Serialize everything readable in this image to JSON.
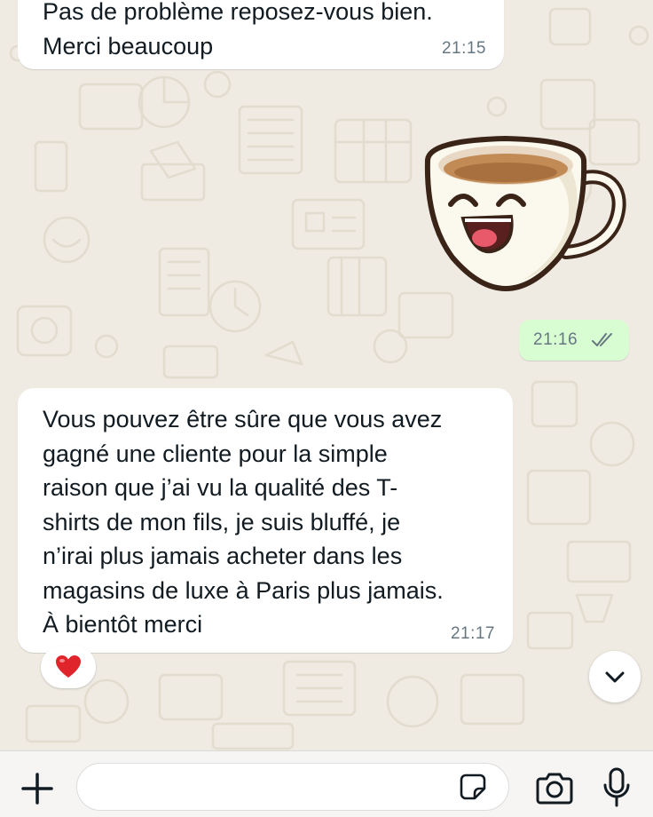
{
  "messages": [
    {
      "direction": "incoming",
      "text": "Pas de problème reposez-vous bien.\nMerci beaucoup",
      "time": "21:15"
    },
    {
      "direction": "outgoing",
      "type": "sticker",
      "sticker": "smiling-coffee-cup",
      "time": "21:16",
      "status": "read"
    },
    {
      "direction": "incoming",
      "text": "Vous pouvez être sûre que vous avez\ngagné une cliente pour la simple\nraison que j’ai vu la qualité des T-\nshirts de mon fils, je suis bluffé, je\nn’irai plus jamais acheter dans les\nmagasins de luxe à Paris plus jamais.\nÀ bientôt merci",
      "time": "21:17",
      "reaction": "❤️"
    }
  ],
  "input_bar": {
    "placeholder": "",
    "icons": [
      "plus-icon",
      "sticker-icon",
      "camera-icon",
      "microphone-icon"
    ]
  },
  "scroll_down_icon": "chevron-down-icon",
  "colors": {
    "chat_background": "#efeae2",
    "incoming_bubble": "#ffffff",
    "outgoing_bubble": "#d9fdd3",
    "read_ticks": "#667781",
    "reaction_heart": "#e0242c"
  }
}
